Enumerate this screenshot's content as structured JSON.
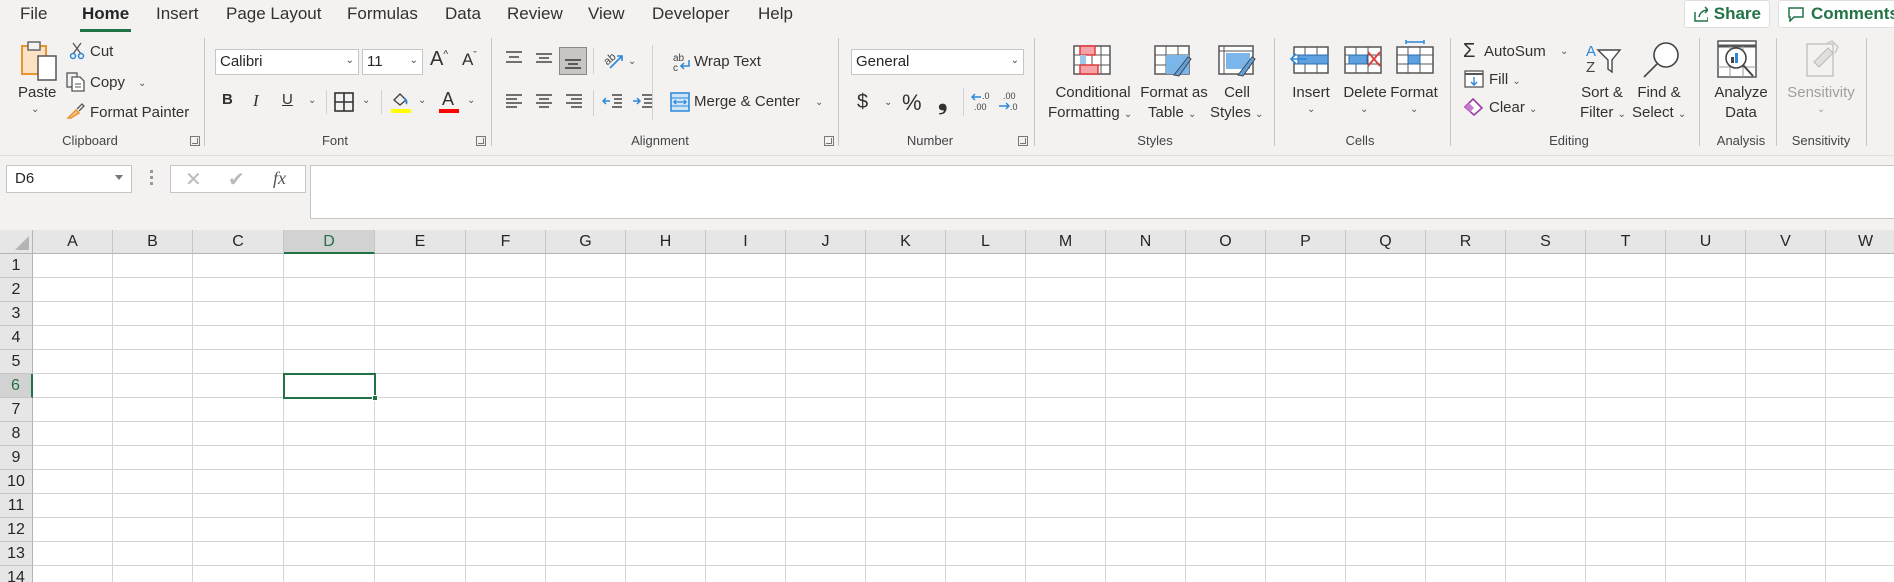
{
  "tabs": [
    "File",
    "Home",
    "Insert",
    "Page Layout",
    "Formulas",
    "Data",
    "Review",
    "View",
    "Developer",
    "Help"
  ],
  "active_tab": "Home",
  "top_buttons": {
    "share": "Share",
    "comments": "Comments"
  },
  "ribbon": {
    "clipboard": {
      "label": "Clipboard",
      "paste": "Paste",
      "cut": "Cut",
      "copy": "Copy",
      "format_painter": "Format Painter"
    },
    "font": {
      "label": "Font",
      "font_name": "Calibri",
      "font_size": "11",
      "bold": "B",
      "italic": "I",
      "underline": "U",
      "highlight_color": "#ffff00",
      "font_color": "#ff0000"
    },
    "alignment": {
      "label": "Alignment",
      "wrap_text": "Wrap Text",
      "merge_center": "Merge & Center"
    },
    "number": {
      "label": "Number",
      "format": "General",
      "currency": "$",
      "percent": "%",
      "comma": "❟"
    },
    "styles": {
      "label": "Styles",
      "conditional_1": "Conditional",
      "conditional_2": "Formatting",
      "format_table_1": "Format as",
      "format_table_2": "Table",
      "cell_styles_1": "Cell",
      "cell_styles_2": "Styles"
    },
    "cells": {
      "label": "Cells",
      "insert": "Insert",
      "delete": "Delete",
      "format": "Format"
    },
    "editing": {
      "label": "Editing",
      "autosum": "AutoSum",
      "fill": "Fill",
      "clear": "Clear",
      "sort_1": "Sort &",
      "sort_2": "Filter",
      "find_1": "Find &",
      "find_2": "Select"
    },
    "analysis": {
      "label": "Analysis",
      "analyze_1": "Analyze",
      "analyze_2": "Data"
    },
    "sensitivity": {
      "label": "Sensitivity",
      "button": "Sensitivity"
    }
  },
  "formula_bar": {
    "name_box": "D6",
    "formula": "",
    "fx": "fx"
  },
  "sheet": {
    "columns": [
      "A",
      "B",
      "C",
      "D",
      "E",
      "F",
      "G",
      "H",
      "I",
      "J",
      "K",
      "L",
      "M",
      "N",
      "O",
      "P",
      "Q",
      "R",
      "S",
      "T",
      "U",
      "V",
      "W"
    ],
    "rows": [
      "1",
      "2",
      "3",
      "4",
      "5",
      "6",
      "7",
      "8",
      "9",
      "10",
      "11",
      "12",
      "13",
      "14"
    ],
    "selected_cell": "D6",
    "accent": "#217346"
  }
}
